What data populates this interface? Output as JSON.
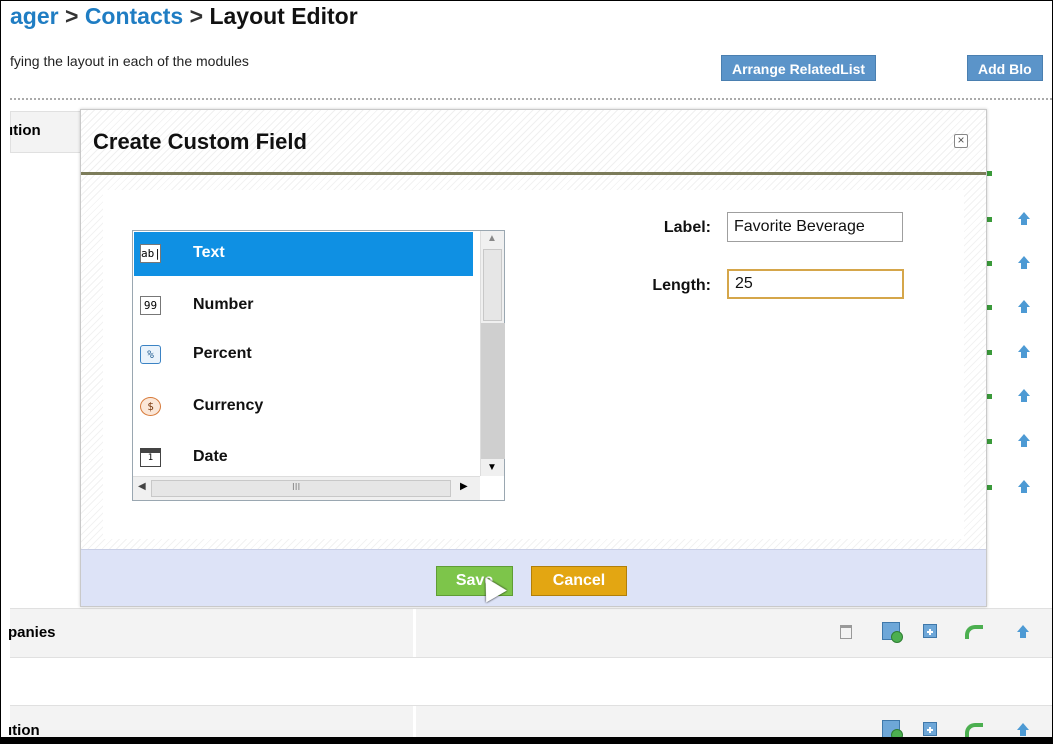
{
  "breadcrumb": {
    "part1": "ager",
    "sep1": " > ",
    "part2": "Contacts",
    "sep2": " > ",
    "current": "Layout Editor"
  },
  "description": "fying the layout in each of the modules",
  "toolbar": {
    "arrange_related": "Arrange RelatedList",
    "add_block": "Add Blo"
  },
  "background": {
    "header_label": "ıtion",
    "companies_label": "panies",
    "info_label": "ıtion"
  },
  "modal": {
    "title": "Create Custom Field",
    "close_glyph": "×",
    "field_types": [
      {
        "icon": "ab|",
        "label": "Text",
        "selected": true
      },
      {
        "icon": "99",
        "label": "Number",
        "selected": false
      },
      {
        "icon": "%",
        "label": "Percent",
        "selected": false
      },
      {
        "icon": "$",
        "label": "Currency",
        "selected": false
      },
      {
        "icon": "1",
        "label": "Date",
        "selected": false
      }
    ],
    "hscroll_grip": "III",
    "label_field": {
      "label": "Label:",
      "value": "Favorite Beverage"
    },
    "length_field": {
      "label": "Length:",
      "value": "25"
    },
    "save_label": "Save",
    "cancel_label": "Cancel"
  },
  "colors": {
    "link": "#1f7dc3",
    "selected": "#0f90e3",
    "save": "#7dc54a",
    "cancel": "#e3a612",
    "footer": "#dde3f7"
  }
}
